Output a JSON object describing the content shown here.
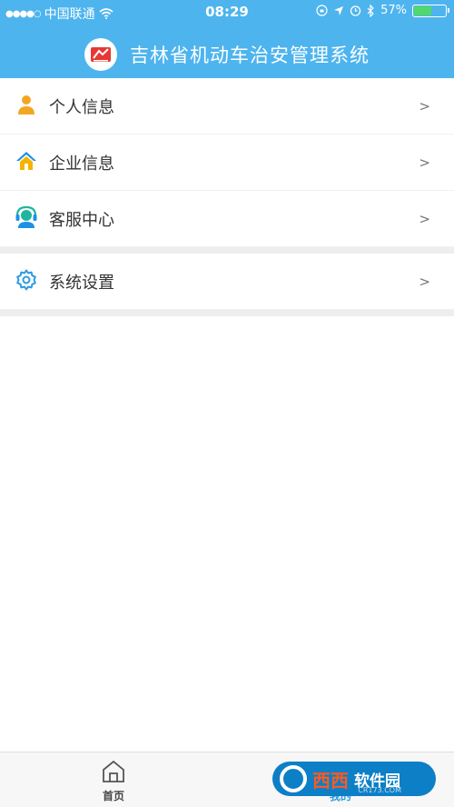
{
  "status_bar": {
    "signal_dots": "●●●●○",
    "carrier": "中国联通",
    "time": "08:29",
    "battery_percent": "57%",
    "battery_level": 0.57
  },
  "header": {
    "title": "吉林省机动车治安管理系统",
    "color": "#4db4ee"
  },
  "menu": {
    "items": [
      {
        "label": "个人信息",
        "chevron": ">",
        "icon": "person-icon",
        "icon_color": "#f4a623"
      },
      {
        "label": "企业信息",
        "chevron": ">",
        "icon": "home-icon",
        "icon_color": "#1e90e6"
      },
      {
        "label": "客服中心",
        "chevron": ">",
        "icon": "customer-service-icon",
        "icon_color": "#1fb5a0"
      },
      {
        "label": "系统设置",
        "chevron": ">",
        "icon": "gear-icon",
        "icon_color": "#2d9be0"
      }
    ]
  },
  "tabbar": {
    "home_label": "首页",
    "mine_label": "我的",
    "active_color": "#2d9be0"
  },
  "watermark": {
    "text1": "西西",
    "text2": "软件园",
    "sub": "CR173.COM"
  }
}
